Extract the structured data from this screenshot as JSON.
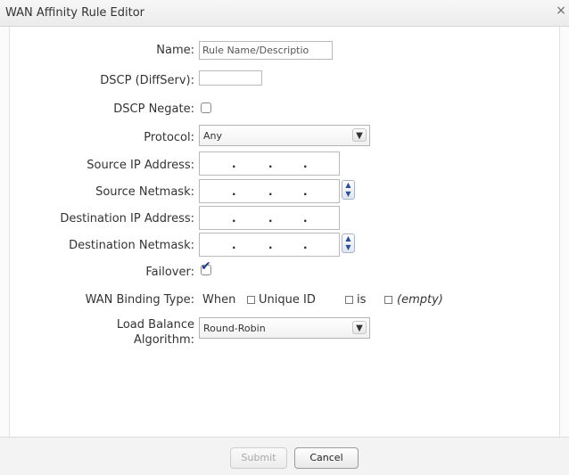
{
  "dialog": {
    "title": "WAN Affinity Rule Editor",
    "close_glyph": "×"
  },
  "form": {
    "name_label": "Name:",
    "name_placeholder": "Rule Name/Descriptio",
    "dscp_label": "DSCP (DiffServ):",
    "dscp_value": "",
    "dscp_negate_label": "DSCP Negate:",
    "dscp_negate_checked": false,
    "protocol_label": "Protocol:",
    "protocol_value": "Any",
    "source_ip_label": "Source IP Address:",
    "source_netmask_label": "Source Netmask:",
    "dest_ip_label": "Destination IP Address:",
    "dest_netmask_label": "Destination Netmask:",
    "failover_label": "Failover:",
    "failover_checked": true,
    "wan_binding_label": "WAN Binding Type:",
    "wan_binding": {
      "when": "When",
      "field": "Unique ID",
      "operator": "is",
      "value": "(empty)",
      "expand_glyph": "⊞"
    },
    "load_balance_label": "Load Balance Algorithm:",
    "load_balance_value": "Round-Robin",
    "ip_separator": "."
  },
  "footer": {
    "submit_label": "Submit",
    "cancel_label": "Cancel"
  },
  "icons": {
    "dropdown_arrow": "▼",
    "spinner_up": "▲",
    "spinner_down": "▼",
    "checkmark": "✔"
  },
  "colors": {
    "checkmark": "#1f3c88",
    "spinner": "#2a4f93"
  }
}
